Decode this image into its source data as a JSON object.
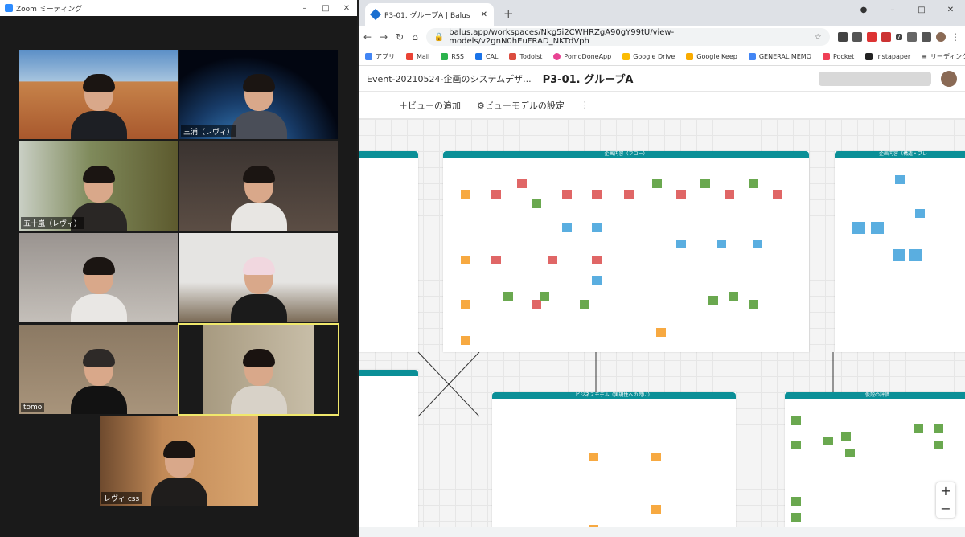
{
  "zoom": {
    "title": "Zoom ミーティング",
    "tiles": [
      {
        "name": ""
      },
      {
        "name": "三浦（レヴィ）"
      },
      {
        "name": "五十嵐（レヴィ）"
      },
      {
        "name": ""
      },
      {
        "name": ""
      },
      {
        "name": ""
      },
      {
        "name": "tomo"
      },
      {
        "name": ""
      },
      {
        "name": "レヴィ css"
      }
    ]
  },
  "browser": {
    "tab_title": "P3-01. グループA | Balus",
    "url": "balus.app/workspaces/Nkg5i2CWHRZgA90gY99tU/view-models/v2gnN0hEuFRAD_NKTdVph",
    "bookmarks": [
      "アプリ",
      "Mail",
      "RSS",
      "CAL",
      "Todoist",
      "PomoDoneApp",
      "Google Drive",
      "Google Keep",
      "GENERAL MEMO",
      "Pocket",
      "Instapaper"
    ],
    "reading_list": "リーディング リスト",
    "ext_badge": "7"
  },
  "app": {
    "breadcrumb": "Event-20210524-企画のシステムデザ...",
    "board_title": "P3-01. グループA",
    "add_view": "ビューの追加",
    "view_settings": "ビューモデルの設定",
    "more": "⋮",
    "boards": [
      {
        "title": "企画内容（フロー）"
      },
      {
        "title": "企画内容（構造・プレ"
      },
      {
        "title": "ビジネスモデル（実現性への問い）"
      },
      {
        "title": "仮説の評価"
      }
    ],
    "zoom_in": "+",
    "zoom_out": "−"
  }
}
